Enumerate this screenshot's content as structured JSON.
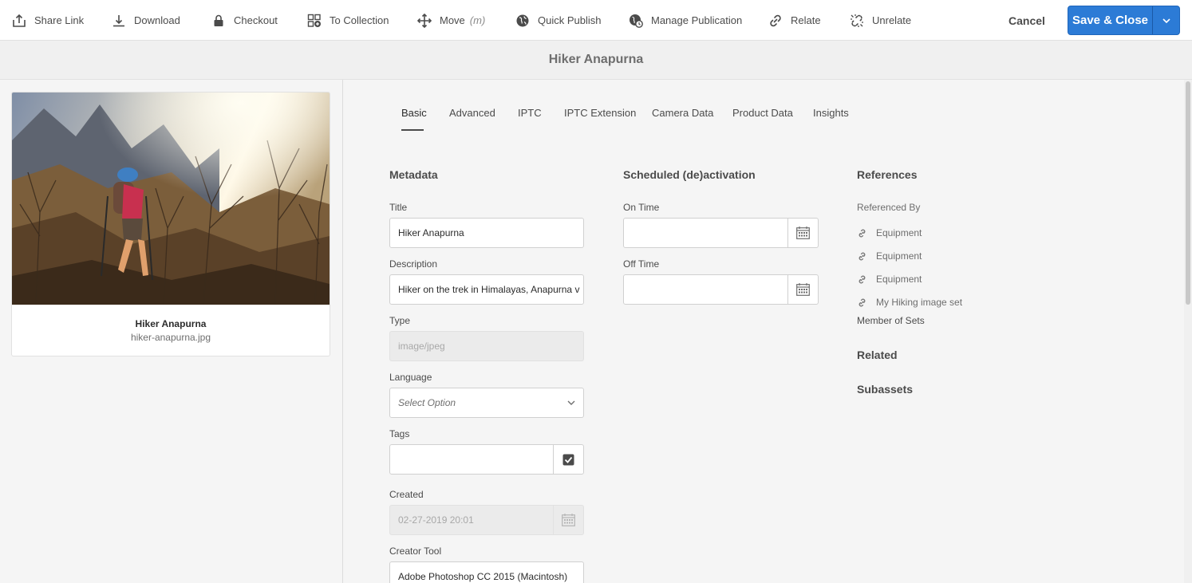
{
  "toolbar": {
    "items": [
      {
        "label": "Share Link",
        "icon": "share-icon"
      },
      {
        "label": "Download",
        "icon": "download-icon"
      },
      {
        "label": "Checkout",
        "icon": "lock-icon"
      },
      {
        "label": "To Collection",
        "icon": "add-to-collection-icon"
      },
      {
        "label": "Move",
        "shortcut": "(m)",
        "icon": "move-icon"
      },
      {
        "label": "Quick Publish",
        "icon": "globe-icon"
      },
      {
        "label": "Manage Publication",
        "icon": "globe-clock-icon"
      },
      {
        "label": "Relate",
        "icon": "link-icon"
      },
      {
        "label": "Unrelate",
        "icon": "unlink-icon"
      }
    ],
    "cancel_label": "Cancel",
    "save_label": "Save & Close"
  },
  "title": "Hiker Anapurna",
  "asset_card": {
    "title": "Hiker Anapurna",
    "filename": "hiker-anapurna.jpg"
  },
  "tabs": [
    "Basic",
    "Advanced",
    "IPTC",
    "IPTC Extension",
    "Camera Data",
    "Product Data",
    "Insights"
  ],
  "active_tab": "Basic",
  "metadata": {
    "heading": "Metadata",
    "title_label": "Title",
    "title_value": "Hiker Anapurna",
    "description_label": "Description",
    "description_value": "Hiker on the trek in Himalayas, Anapurna v",
    "type_label": "Type",
    "type_value": "image/jpeg",
    "language_label": "Language",
    "language_placeholder": "Select Option",
    "tags_label": "Tags",
    "tags_value": "",
    "created_label": "Created",
    "created_value": "02-27-2019 20:01",
    "creator_tool_label": "Creator Tool",
    "creator_tool_value": "Adobe Photoshop CC 2015 (Macintosh)"
  },
  "schedule": {
    "heading": "Scheduled (de)activation",
    "on_time_label": "On Time",
    "on_time_value": "",
    "off_time_label": "Off Time",
    "off_time_value": ""
  },
  "references": {
    "heading": "References",
    "referenced_by_label": "Referenced By",
    "referenced_by": [
      "Equipment",
      "Equipment",
      "Equipment",
      "My Hiking image set"
    ],
    "member_of_sets_label": "Member of Sets",
    "related_heading": "Related",
    "subassets_heading": "Subassets"
  },
  "colors": {
    "primary": "#2c7bd6",
    "text": "#4b4b4b",
    "background": "#f5f5f5"
  }
}
